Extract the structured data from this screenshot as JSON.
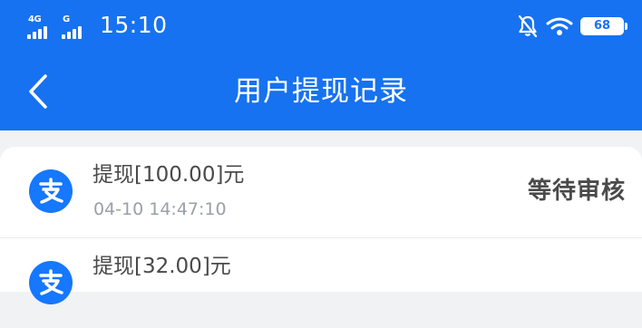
{
  "statusbar": {
    "network1": "4G",
    "network2": "G",
    "time": "15:10",
    "battery": "68"
  },
  "navbar": {
    "title": "用户提现记录"
  },
  "records": [
    {
      "title": "提现[100.00]元",
      "date": "04-10 14:47:10",
      "status": "等待审核",
      "icon": "alipay-icon"
    },
    {
      "title": "提现[32.00]元",
      "icon": "alipay-icon"
    }
  ],
  "colors": {
    "header": "#1672f0",
    "alipay": "#1677ff",
    "background": "#f1f2f4"
  }
}
